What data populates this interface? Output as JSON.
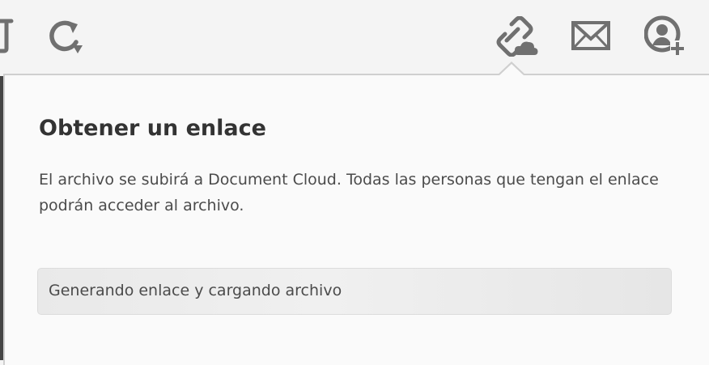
{
  "toolbar": {
    "icons": {
      "trash": "trash-icon",
      "rotate": "rotate-icon",
      "link_cloud": "link-cloud-icon",
      "mail": "mail-icon",
      "add_user": "add-user-icon"
    },
    "icon_color": "#707070"
  },
  "popover": {
    "title": "Obtener un enlace",
    "description": "El archivo se subirá a Document Cloud. Todas las personas que tengan el enlace podrán acceder al archivo.",
    "progress_label": "Generando enlace y cargando archivo"
  },
  "colors": {
    "background": "#f4f4f4",
    "popover_background": "#fafafa",
    "popover_border": "#cfcfcf",
    "text_primary": "#333333",
    "text_secondary": "#4b4b4b"
  }
}
